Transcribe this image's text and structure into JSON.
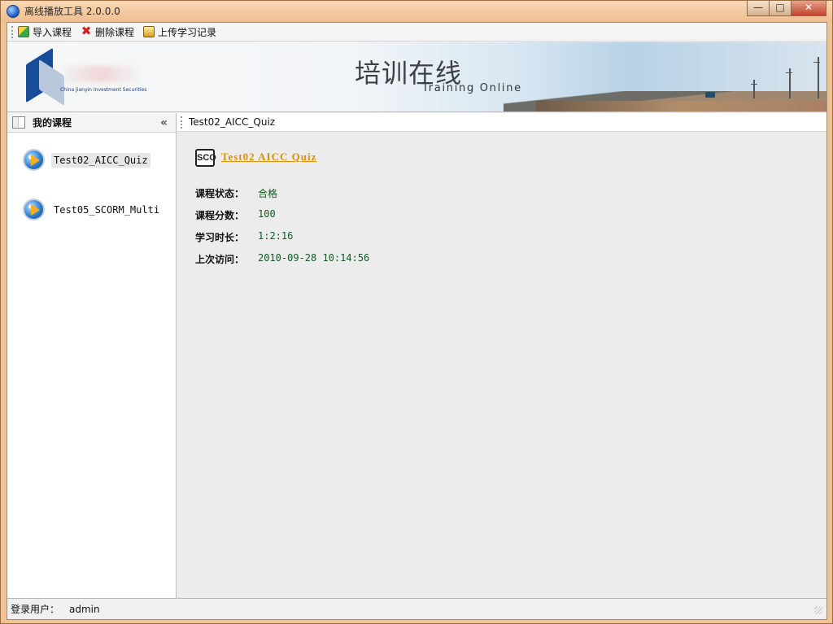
{
  "window": {
    "title": "离线播放工具 2.0.0.0",
    "minimize": "—",
    "maximize": "□",
    "close": "✕"
  },
  "toolbar": {
    "import_label": "导入课程",
    "delete_label": "删除课程",
    "upload_label": "上传学习记录"
  },
  "banner": {
    "title": "培训在线",
    "subtitle": "Training Online",
    "logo_text": "China Jianyin Investment Securities"
  },
  "sidebar": {
    "title": "我的课程",
    "collapse": "«",
    "courses": [
      {
        "name": "Test02_AICC_Quiz"
      },
      {
        "name": "Test05_SCORM_Multi"
      }
    ]
  },
  "content": {
    "tab": "Test02_AICC_Quiz",
    "sco_label": "SCO",
    "course_title": "Test02 AICC Quiz",
    "details": [
      {
        "label": "课程状态：",
        "value": "合格"
      },
      {
        "label": "课程分数：",
        "value": "100"
      },
      {
        "label": "学习时长：",
        "value": "1:2:16"
      },
      {
        "label": "上次访问：",
        "value": "2010-09-28 10:14:56"
      }
    ]
  },
  "status": {
    "user_label": "登录用户：",
    "user_name": "admin"
  },
  "icons": {
    "app": "app-icon",
    "import": "import-icon",
    "delete": "delete-icon",
    "upload": "upload-icon",
    "course": "play-icon"
  },
  "colors": {
    "window_frame": "#efc394",
    "link": "#df8f00",
    "value": "#115b22",
    "brand_blue": "#174c99"
  }
}
